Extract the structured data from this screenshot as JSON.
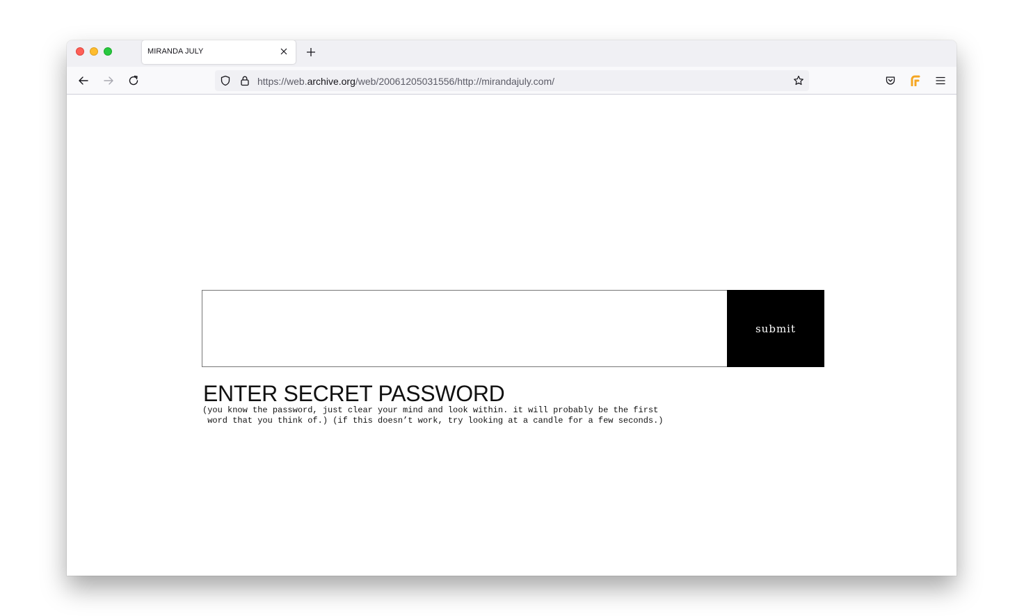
{
  "browser": {
    "tab": {
      "title": "MIRANDA JULY"
    },
    "urlbar": {
      "prefix": "https://web.",
      "domain": "archive.org",
      "suffix": "/web/20061205031556/http://mirandajuly.com/"
    }
  },
  "page": {
    "submit_label": "submit",
    "headline": "ENTER SECRET PASSWORD",
    "instructions_line1": "(you know the password, just clear your mind and look within. it will probably be the first",
    "instructions_line2": " word that you think of.) (if this doesn’t work, try looking at a candle for a few seconds.)"
  },
  "colors": {
    "submit_background": "#000000",
    "extension_accent": "#f5a623"
  },
  "icons": [
    "close-icon",
    "plus-icon",
    "back-arrow-icon",
    "forward-arrow-icon",
    "reload-icon",
    "shield-icon",
    "lock-icon",
    "star-icon",
    "pocket-icon",
    "extension-icon",
    "hamburger-menu-icon"
  ]
}
